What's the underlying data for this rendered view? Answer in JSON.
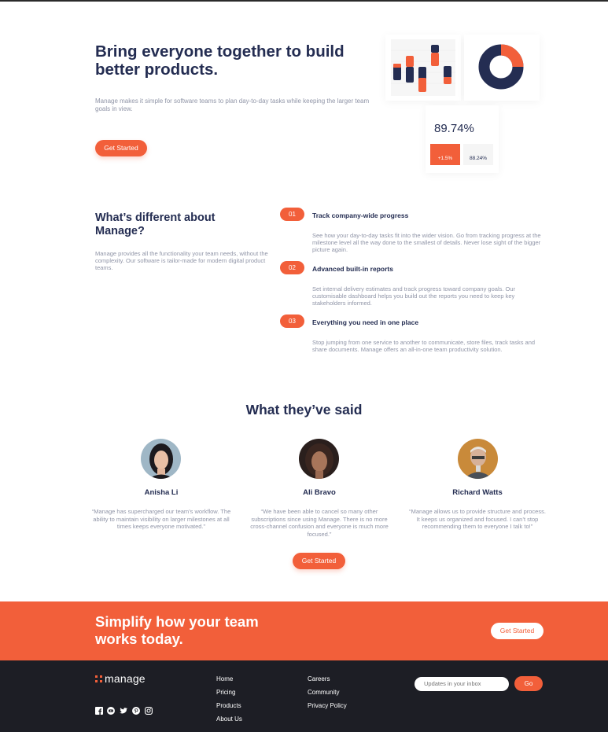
{
  "hero": {
    "title": "Bring everyone together to build better products.",
    "description": "Manage makes it simple for software teams to plan day-to-day tasks while keeping the larger team goals in view.",
    "cta_label": "Get Started",
    "stats": {
      "main_value": "89.74%",
      "change_value": "+1.5%",
      "secondary_value": "88.24%"
    }
  },
  "features": {
    "title": "What’s different about Manage?",
    "description": "Manage provides all the functionality your team needs, without the complexity. Our software is tailor-made for modern digital product teams.",
    "items": [
      {
        "number": "01",
        "title": "Track company-wide progress",
        "description": "See how your day-to-day tasks fit into the wider vision. Go from tracking progress at the milestone level all the way done to the smallest of details. Never lose sight of the bigger picture again."
      },
      {
        "number": "02",
        "title": "Advanced built-in reports",
        "description": "Set internal delivery estimates and track progress toward company goals. Our customisable dashboard helps you build out the reports you need to keep key stakeholders informed."
      },
      {
        "number": "03",
        "title": "Everything you need in one place",
        "description": "Stop jumping from one service to another to communicate, store files, track tasks and share documents. Manage offers an all-in-one team productivity solution."
      }
    ]
  },
  "testimonials": {
    "heading": "What they’ve said",
    "items": [
      {
        "name": "Anisha Li",
        "quote": "“Manage has supercharged our team’s workflow. The ability to maintain visibility on larger milestones at all times keeps everyone motivated.”",
        "avatar": "avatar-anisha"
      },
      {
        "name": "Ali Bravo",
        "quote": "“We have been able to cancel so many other subscriptions since using Manage. There is no more cross-channel confusion and everyone is much more focused.”",
        "avatar": "avatar-ali"
      },
      {
        "name": "Richard Watts",
        "quote": "“Manage allows us to provide structure and process. It keeps us organized and focused. I can’t stop recommending them to everyone I talk to!”",
        "avatar": "avatar-richard"
      }
    ],
    "cta_label": "Get Started"
  },
  "cta_banner": {
    "title": "Simplify how your team works today.",
    "button_label": "Get Started"
  },
  "footer": {
    "logo_text": "manage",
    "social_icons": [
      "facebook-icon",
      "youtube-icon",
      "twitter-icon",
      "pinterest-icon",
      "instagram-icon"
    ],
    "links_col1": [
      "Home",
      "Pricing",
      "Products",
      "About Us"
    ],
    "links_col2": [
      "Careers",
      "Community",
      "Privacy Policy"
    ],
    "newsletter_placeholder": "Updates in your inbox",
    "go_label": "Go"
  },
  "colors": {
    "accent": "#f25f3a",
    "navy": "#242d52",
    "gray_text": "#9095a7",
    "footer_bg": "#1d1e25"
  }
}
